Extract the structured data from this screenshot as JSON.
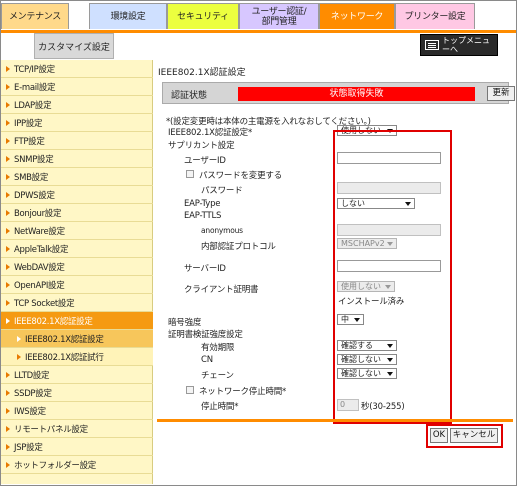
{
  "tabs": [
    {
      "label": "メンテナンス",
      "color": "#ffd98a"
    },
    {
      "label": "環境設定",
      "color": "#cfe0ff"
    },
    {
      "label": "セキュリティ",
      "color": "#ecff3f"
    },
    {
      "label": "ユーザー認証/部門管理",
      "color": "#d7c7ff"
    },
    {
      "label": "ネットワーク",
      "color": "#ff8c00"
    },
    {
      "label": "プリンター設定",
      "color": "#ffc8e4"
    }
  ],
  "subtab": {
    "label": "カスタマイズ設定"
  },
  "topmenu": {
    "label": "トップメニューへ"
  },
  "sidebar": {
    "items": [
      {
        "label": "TCP/IP設定"
      },
      {
        "label": "E-mail設定"
      },
      {
        "label": "LDAP設定"
      },
      {
        "label": "IPP設定"
      },
      {
        "label": "FTP設定"
      },
      {
        "label": "SNMP設定"
      },
      {
        "label": "SMB設定"
      },
      {
        "label": "DPWS設定"
      },
      {
        "label": "Bonjour設定"
      },
      {
        "label": "NetWare設定"
      },
      {
        "label": "AppleTalk設定"
      },
      {
        "label": "WebDAV設定"
      },
      {
        "label": "OpenAPI設定"
      },
      {
        "label": "TCP Socket設定"
      },
      {
        "label": "IEEE802.1X認証設定"
      },
      {
        "label": "IEEE802.1X認証設定"
      },
      {
        "label": "IEEE802.1X認証試行"
      },
      {
        "label": "LLTD設定"
      },
      {
        "label": "SSDP設定"
      },
      {
        "label": "IWS設定"
      },
      {
        "label": "リモートパネル設定"
      },
      {
        "label": "JSP設定"
      },
      {
        "label": "ホットフォルダー設定"
      }
    ]
  },
  "main": {
    "title": "IEEE802.1X認証設定",
    "status_label": "認証状態",
    "status_value": "状態取得失敗",
    "refresh": "更新",
    "note": "*(設定変更時は本体の主電源を入れなおしてください。)",
    "ieee_label": "IEEE802.1X認証設定*",
    "ieee_value": "使用しない",
    "supplicant": "サプリカント設定",
    "userid": "ユーザーID",
    "change_pw": "パスワードを変更する",
    "password": "パスワード",
    "eap_type": "EAP-Type",
    "eap_type_value": "しない",
    "eap_ttls": "EAP-TTLS",
    "anonymous": "anonymous",
    "inner_proto": "内部認証プロトコル",
    "inner_proto_value": "MSCHAPv2",
    "server_id": "サーバーID",
    "client_cert": "クライアント証明書",
    "client_cert_value": "使用しない",
    "installed": "インストール済み",
    "cipher": "暗号強度",
    "cipher_value": "中",
    "cert_verify": "証明書検証強度設定",
    "validity": "有効期限",
    "validity_value": "確認する",
    "cn": "CN",
    "cn_value": "確認しない",
    "chain": "チェーン",
    "chain_value": "確認しない",
    "net_stop": "ネットワーク停止時間*",
    "stop_time": "停止時間*",
    "stop_value": "0",
    "stop_unit": "秒(30-255)",
    "ok": "OK",
    "cancel": "キャンセル"
  }
}
